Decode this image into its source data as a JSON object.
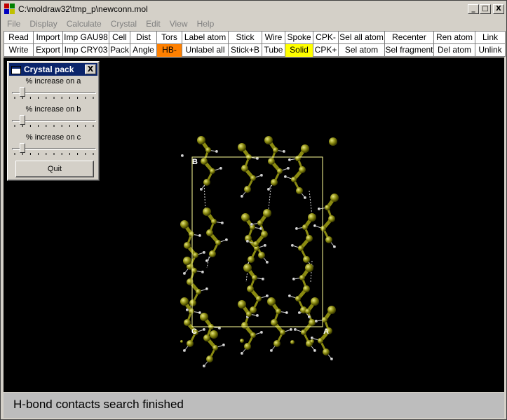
{
  "window": {
    "title": "C:\\moldraw32\\tmp_p\\newconn.mol"
  },
  "window_buttons": [
    "_",
    "□",
    "X"
  ],
  "menu": [
    "File",
    "Display",
    "Calculate",
    "Crystal",
    "Edit",
    "View",
    "Help"
  ],
  "toolbar": {
    "row1": [
      "Read",
      "Import",
      "Imp GAU98",
      "Cell",
      "Dist",
      "Tors",
      "Label atom",
      "Stick",
      "Wire",
      "Spoke",
      "CPK-",
      "Sel all atom",
      "Recenter",
      "Ren atom",
      "Link"
    ],
    "row2": [
      "Write",
      "Export",
      "Imp CRY03",
      "Pack",
      "Angle",
      "HB-",
      "Unlabel all",
      "Stick+B",
      "Tube",
      "Solid",
      "CPK+",
      "Sel atom",
      "Sel fragment",
      "Del atom",
      "Unlink"
    ],
    "highlight_hb": "#ff8000",
    "highlight_solid": "#ffff00"
  },
  "dialog": {
    "title": "Crystal pack",
    "close": "X",
    "sliders": [
      {
        "label": "% increase on a",
        "value": 0.1
      },
      {
        "label": "% increase on b",
        "value": 0.1
      },
      {
        "label": "% increase on c",
        "value": 0.1
      }
    ],
    "quit_label": "Quit"
  },
  "viewer": {
    "axis_labels": {
      "a": "A",
      "b": "B",
      "c": "C"
    },
    "cell_color": "#ffff99",
    "atom_color": "#8a8a10",
    "hydrogen_color": "#e0e0e0",
    "background": "#000000"
  },
  "status": {
    "text": "H-bond contacts search finished"
  }
}
